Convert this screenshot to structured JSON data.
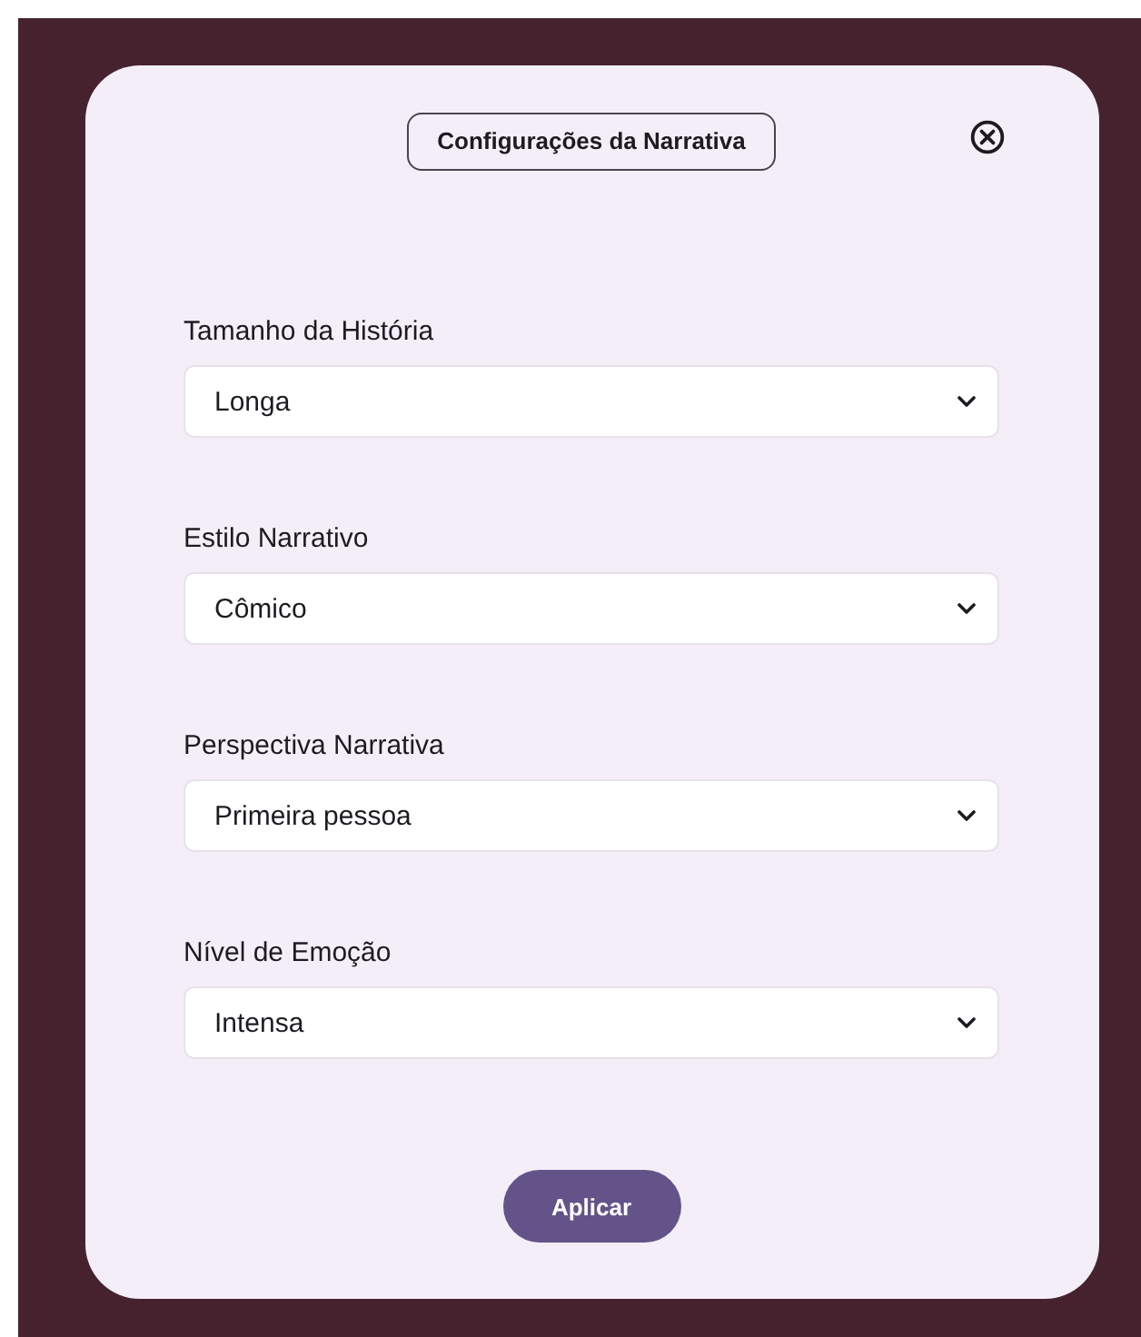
{
  "dialog": {
    "title": "Configurações da Narrativa",
    "fields": [
      {
        "label": "Tamanho da História",
        "value": "Longa"
      },
      {
        "label": "Estilo Narrativo",
        "value": "Cômico"
      },
      {
        "label": "Perspectiva Narrativa",
        "value": "Primeira pessoa"
      },
      {
        "label": "Nível de Emoção",
        "value": "Intensa"
      }
    ],
    "apply_button": "Aplicar"
  }
}
